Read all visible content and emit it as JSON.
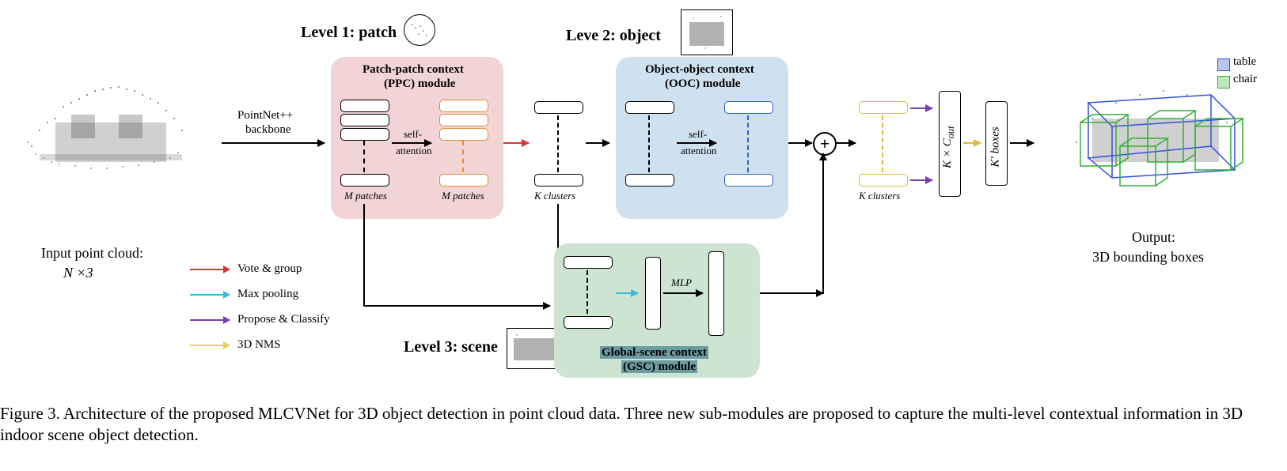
{
  "levels": {
    "l1": "Level 1: patch",
    "l2": "Leve 2: object",
    "l3": "Level 3: scene"
  },
  "modules": {
    "ppc_title1": "Patch-patch context",
    "ppc_title2": "(PPC) module",
    "ooc_title1": "Object-object context",
    "ooc_title2": "(OOC) module",
    "gsc_title1": "Global-scene context",
    "gsc_title2": "(GSC) module"
  },
  "annotations": {
    "backbone1": "PointNet++",
    "backbone2": "backbone",
    "self_attn": "self-",
    "self_attn2": "attention",
    "m_patches": "M patches",
    "k_clusters": "K clusters",
    "mlp": "MLP",
    "k_cout": "K × C",
    "k_cout_sub": "out",
    "k_boxes": "K' boxes"
  },
  "input": {
    "l1": "Input point cloud:",
    "l2": "N ×3"
  },
  "output": {
    "l1": "Output:",
    "l2": "3D bounding boxes"
  },
  "legend": {
    "vote": "Vote & group",
    "maxpool": "Max pooling",
    "propose": "Propose & Classify",
    "nms": "3D NMS",
    "table": "table",
    "chair": "chair"
  },
  "caption": "Figure 3. Architecture of the proposed MLCVNet for 3D object detection in point cloud data.  Three new sub-modules are proposed to capture the multi-level contextual information in 3D indoor scene object detection."
}
